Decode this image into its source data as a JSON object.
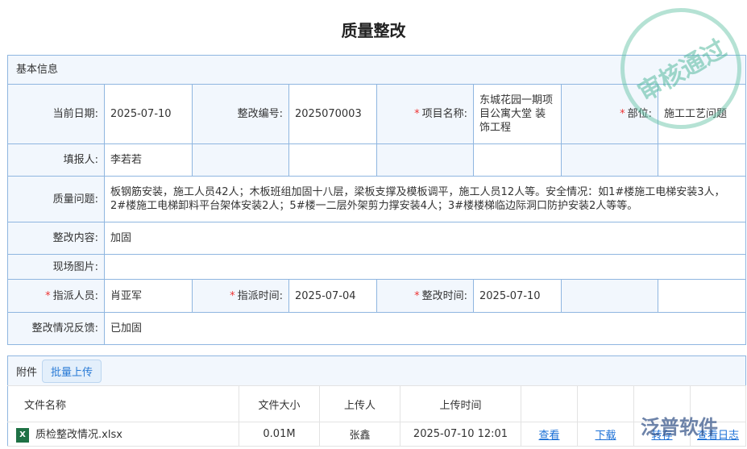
{
  "title": "质量整改",
  "basic": {
    "section": "基本信息",
    "current_date_label": "当前日期:",
    "current_date": "2025-07-10",
    "code_label": "整改编号:",
    "code": "2025070003",
    "project_label": "项目名称:",
    "project": "东城花园一期项目公寓大堂 装饰工程",
    "dept_label": "部位:",
    "dept": "施工工艺问题",
    "reporter_label": "填报人:",
    "reporter": "李若若",
    "issue_label": "质量问题:",
    "issue": "板钢筋安装，施工人员42人；木板班组加固十八层，梁板支撑及模板调平，施工人员12人等。安全情况：如1#楼施工电梯安装3人，2#楼施工电梯卸料平台架体安装2人；5#楼一二层外架剪力撑安装4人；3#楼楼梯临边际洞口防护安装2人等等。",
    "content_label": "整改内容:",
    "content": "加固",
    "photo_label": "现场图片:",
    "assignee_label": "指派人员:",
    "assignee": "肖亚军",
    "assign_time_label": "指派时间:",
    "assign_time": "2025-07-04",
    "fix_time_label": "整改时间:",
    "fix_time": "2025-07-10",
    "feedback_label": "整改情况反馈:",
    "feedback": "已加固"
  },
  "attachments": {
    "section": "附件",
    "upload_button": "批量上传",
    "columns": [
      "文件名称",
      "文件大小",
      "上传人",
      "上传时间"
    ],
    "rows": [
      {
        "name": "质检整改情况.xlsx",
        "size": "0.01M",
        "uploader": "张鑫",
        "time": "2025-07-10 12:01",
        "actions": [
          "查看",
          "下载",
          "转存",
          "查看日志"
        ]
      }
    ]
  },
  "stamp": "审核通过",
  "logo": "泛普软件"
}
